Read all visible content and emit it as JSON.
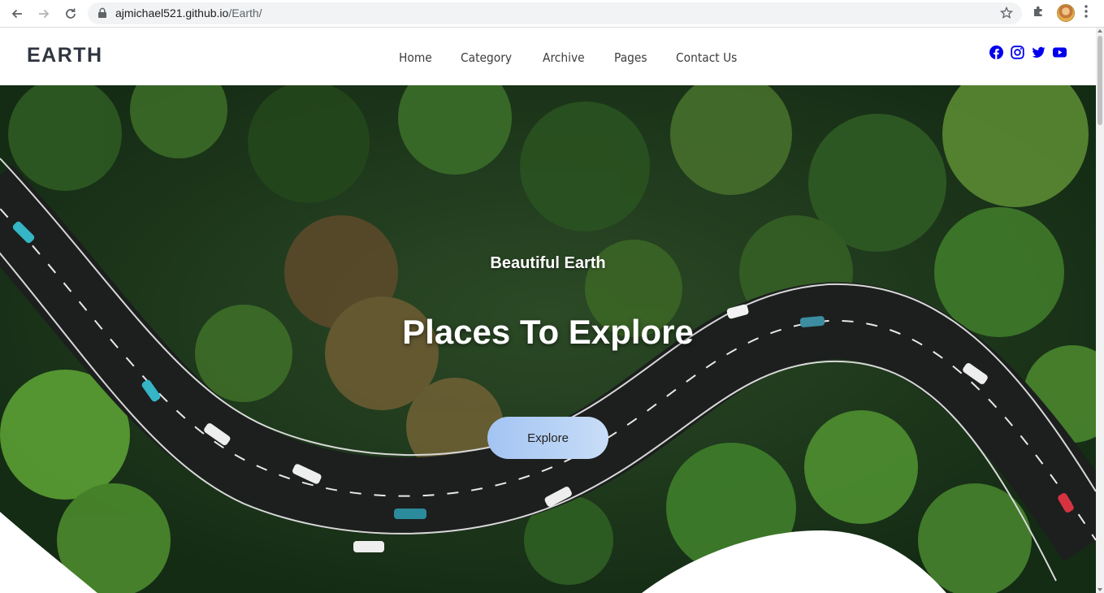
{
  "browser": {
    "url_host": "ajmichael521.github.io",
    "url_path": "/Earth/"
  },
  "site": {
    "logo": "EARTH",
    "nav": [
      {
        "label": "Home"
      },
      {
        "label": "Category"
      },
      {
        "label": "Archive"
      },
      {
        "label": "Pages"
      },
      {
        "label": "Contact Us"
      }
    ],
    "social": [
      "facebook-icon",
      "instagram-icon",
      "twitter-icon",
      "youtube-icon"
    ],
    "accent_color": "#0000ee"
  },
  "hero": {
    "tagline": "Beautiful Earth",
    "headline": "Places To Explore",
    "button_label": "Explore"
  }
}
